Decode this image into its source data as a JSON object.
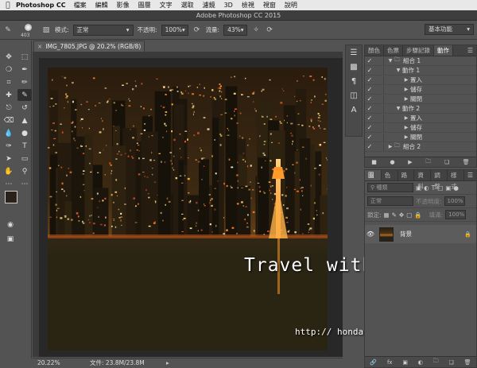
{
  "menubar": {
    "app": "Photoshop CC",
    "items": [
      "檔案",
      "編輯",
      "影像",
      "圖層",
      "文字",
      "選取",
      "濾鏡",
      "3D",
      "檢視",
      "視窗",
      "說明"
    ]
  },
  "window_title": "Adobe Photoshop CC 2015",
  "options": {
    "brush_size": "403",
    "mode_label": "模式:",
    "mode_value": "正常",
    "opacity_label": "不透明:",
    "opacity_value": "100%",
    "flow_label": "流量:",
    "flow_value": "43%",
    "workspace": "基本功能"
  },
  "document": {
    "tab_title": "IMG_7805.JPG @ 20.2% (RGB/8) *",
    "close_glyph": "×"
  },
  "status": {
    "zoom": "20.22%",
    "file_info": "文件: 23.8M/23.8M"
  },
  "watermark": {
    "line1": "Travel with Honda",
    "line2": "http:// hondayellow.pixnet.net"
  },
  "actions_panel": {
    "tabs": [
      "顏色",
      "色票",
      "步驟記錄",
      "動作"
    ],
    "active_tab": 3,
    "rows": [
      {
        "label": "組合 1",
        "indent": 0,
        "folder": true,
        "expanded": true
      },
      {
        "label": "動作 1",
        "indent": 1,
        "folder": false,
        "expanded": true
      },
      {
        "label": "置入",
        "indent": 2,
        "folder": false,
        "expanded": false
      },
      {
        "label": "儲存",
        "indent": 2,
        "folder": false,
        "expanded": false
      },
      {
        "label": "關閉",
        "indent": 2,
        "folder": false,
        "expanded": false
      },
      {
        "label": "動作 2",
        "indent": 1,
        "folder": false,
        "expanded": true
      },
      {
        "label": "置入",
        "indent": 2,
        "folder": false,
        "expanded": false
      },
      {
        "label": "儲存",
        "indent": 2,
        "folder": false,
        "expanded": false
      },
      {
        "label": "關閉",
        "indent": 2,
        "folder": false,
        "expanded": false
      },
      {
        "label": "組合 2",
        "indent": 0,
        "folder": true,
        "expanded": false
      }
    ]
  },
  "layers_panel": {
    "tabs": [
      "圖層",
      "色版",
      "路徑",
      "資料",
      "調整",
      "樣式"
    ],
    "active_tab": 0,
    "filter_placeholder": "種類",
    "blend_mode": "正常",
    "opacity_label": "不透明度:",
    "opacity_value": "100%",
    "lock_label": "鎖定:",
    "fill_label": "填滿:",
    "fill_value": "100%",
    "layer_name": "背景"
  }
}
